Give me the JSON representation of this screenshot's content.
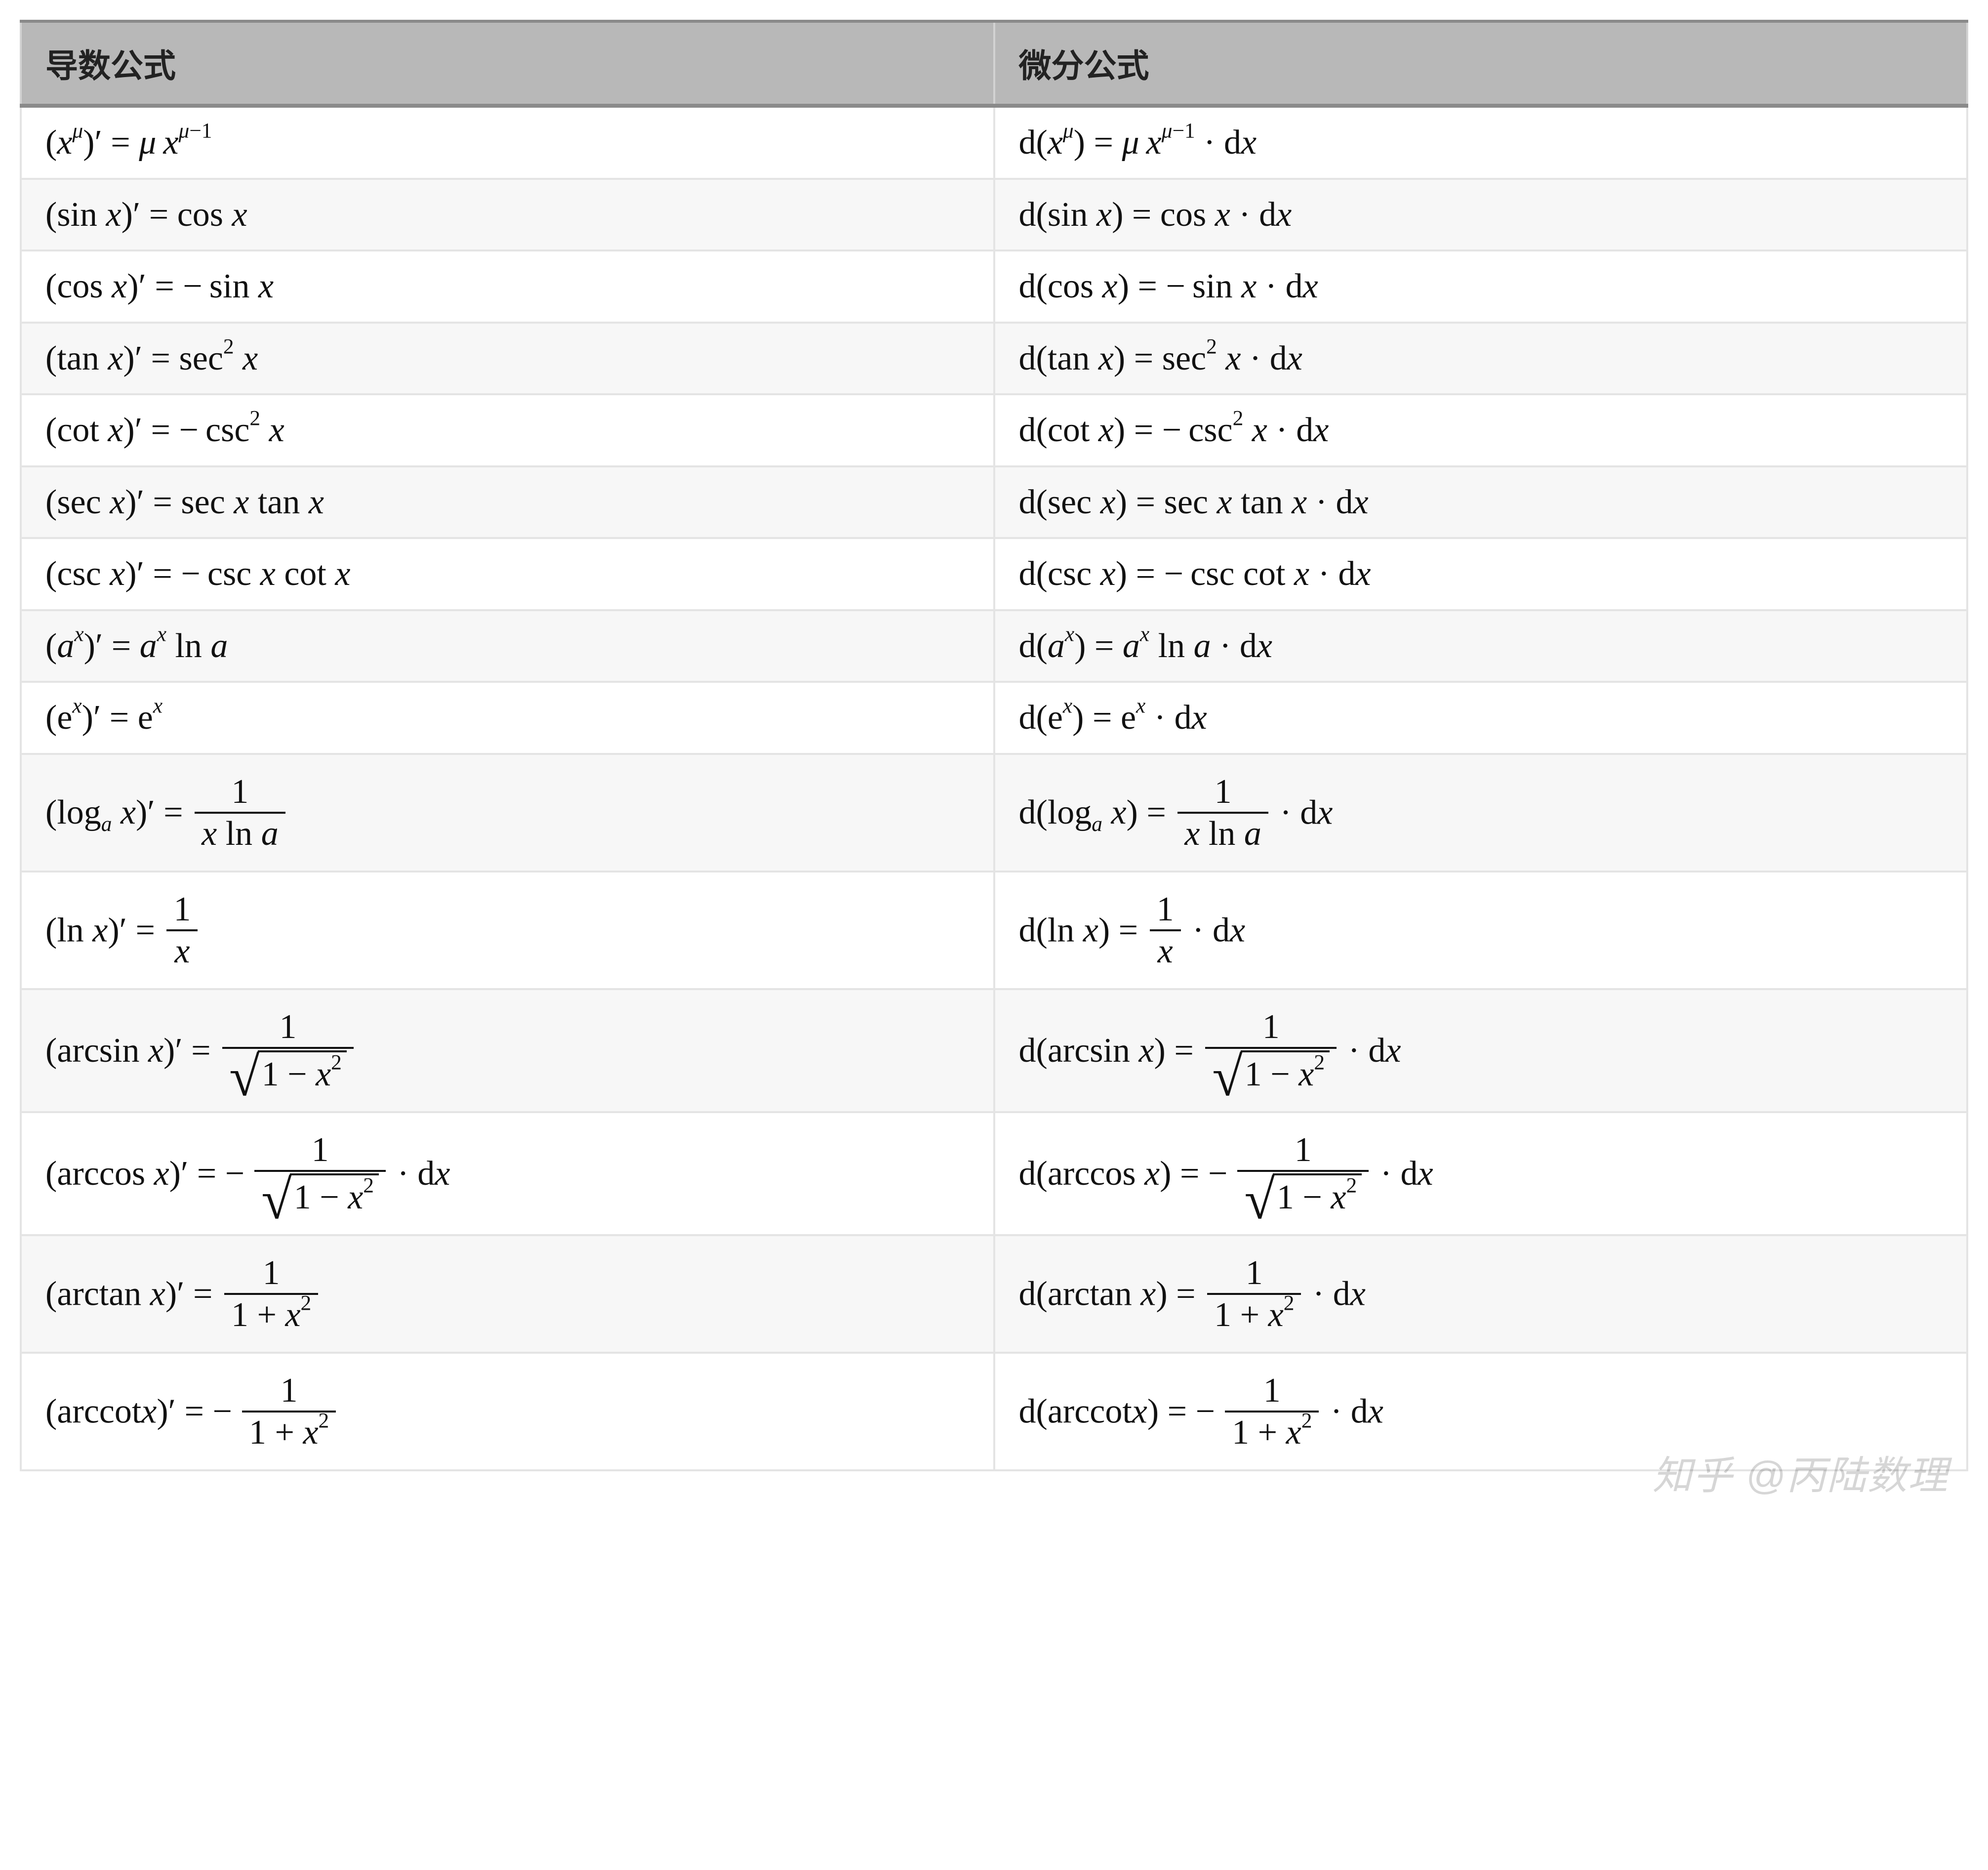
{
  "headers": {
    "derivative": "导数公式",
    "differential": "微分公式"
  },
  "rows": [
    {
      "derivative_html": "(<span class='mi'>x</span><sup><span class='mi'>μ</span></sup>)<span class='mr'>′</span> = <span class='mi'>μ</span>&thinsp;<span class='mi'>x</span><sup><span class='mi'>μ</span>−1</sup>",
      "differential_html": "<span class='mr'>d</span>(<span class='mi'>x</span><sup><span class='mi'>μ</span></sup>) = <span class='mi'>μ</span>&thinsp;<span class='mi'>x</span><sup><span class='mi'>μ</span>−1</sup> · <span class='mr'>d</span><span class='mi'>x</span>"
    },
    {
      "derivative_html": "(<span class='op'>sin</span> <span class='mi'>x</span>)<span class='mr'>′</span> = <span class='op'>cos</span> <span class='mi'>x</span>",
      "differential_html": "<span class='mr'>d</span>(<span class='op'>sin</span> <span class='mi'>x</span>) = <span class='op'>cos</span> <span class='mi'>x</span> · <span class='mr'>d</span><span class='mi'>x</span>"
    },
    {
      "derivative_html": "(<span class='op'>cos</span> <span class='mi'>x</span>)<span class='mr'>′</span> = −&thinsp;<span class='op'>sin</span> <span class='mi'>x</span>",
      "differential_html": "<span class='mr'>d</span>(<span class='op'>cos</span> <span class='mi'>x</span>) = −&thinsp;<span class='op'>sin</span> <span class='mi'>x</span> · <span class='mr'>d</span><span class='mi'>x</span>"
    },
    {
      "derivative_html": "(<span class='op'>tan</span> <span class='mi'>x</span>)<span class='mr'>′</span> = <span class='op'>sec</span><sup>2</sup> <span class='mi'>x</span>",
      "differential_html": "<span class='mr'>d</span>(<span class='op'>tan</span> <span class='mi'>x</span>) = <span class='op'>sec</span><sup>2</sup> <span class='mi'>x</span> · <span class='mr'>d</span><span class='mi'>x</span>"
    },
    {
      "derivative_html": "(<span class='op'>cot</span> <span class='mi'>x</span>)<span class='mr'>′</span> = −&thinsp;<span class='op'>csc</span><sup>2</sup> <span class='mi'>x</span>",
      "differential_html": "<span class='mr'>d</span>(<span class='op'>cot</span> <span class='mi'>x</span>) = −&thinsp;<span class='op'>csc</span><sup>2</sup> <span class='mi'>x</span> · <span class='mr'>d</span><span class='mi'>x</span>"
    },
    {
      "derivative_html": "(<span class='op'>sec</span> <span class='mi'>x</span>)<span class='mr'>′</span> = <span class='op'>sec</span> <span class='mi'>x</span>&nbsp;<span class='op'>tan</span> <span class='mi'>x</span>",
      "differential_html": "<span class='mr'>d</span>(<span class='op'>sec</span> <span class='mi'>x</span>) = <span class='op'>sec</span> <span class='mi'>x</span>&nbsp;<span class='op'>tan</span> <span class='mi'>x</span> · <span class='mr'>d</span><span class='mi'>x</span>"
    },
    {
      "derivative_html": "(<span class='op'>csc</span> <span class='mi'>x</span>)<span class='mr'>′</span> = −&thinsp;<span class='op'>csc</span> <span class='mi'>x</span>&nbsp;<span class='op'>cot</span> <span class='mi'>x</span>",
      "differential_html": "<span class='mr'>d</span>(<span class='op'>csc</span> <span class='mi'>x</span>) = −&thinsp;<span class='op'>csc</span>&nbsp;<span class='op'>cot</span> <span class='mi'>x</span> · <span class='mr'>d</span><span class='mi'>x</span>"
    },
    {
      "derivative_html": "(<span class='mi'>a</span><sup><span class='mi'>x</span></sup>)<span class='mr'>′</span> = <span class='mi'>a</span><sup><span class='mi'>x</span></sup>&nbsp;<span class='op'>ln</span> <span class='mi'>a</span>",
      "differential_html": "<span class='mr'>d</span>(<span class='mi'>a</span><sup><span class='mi'>x</span></sup>) = <span class='mi'>a</span><sup><span class='mi'>x</span></sup>&nbsp;<span class='op'>ln</span> <span class='mi'>a</span> · <span class='mr'>d</span><span class='mi'>x</span>"
    },
    {
      "derivative_html": "(<span class='mr'>e</span><sup><span class='mi'>x</span></sup>)<span class='mr'>′</span> = <span class='mr'>e</span><sup><span class='mi'>x</span></sup>",
      "differential_html": "<span class='mr'>d</span>(<span class='mr'>e</span><sup><span class='mi'>x</span></sup>) = <span class='mr'>e</span><sup><span class='mi'>x</span></sup> · <span class='mr'>d</span><span class='mi'>x</span>"
    },
    {
      "derivative_html": "<span class='mid'>(<span class='op'>log</span><sub><span class='mi'>a</span></sub> <span class='mi'>x</span>)<span class='mr'>′</span> = </span><span class='frac'><span class='num'>1</span><span class='den'><span class='mi'>x</span>&nbsp;<span class='op'>ln</span> <span class='mi'>a</span></span></span>",
      "differential_html": "<span class='mid'><span class='mr'>d</span>(<span class='op'>log</span><sub><span class='mi'>a</span></sub> <span class='mi'>x</span>) = </span><span class='frac'><span class='num'>1</span><span class='den'><span class='mi'>x</span>&nbsp;<span class='op'>ln</span> <span class='mi'>a</span></span></span><span class='mid'> · <span class='mr'>d</span><span class='mi'>x</span></span>"
    },
    {
      "derivative_html": "<span class='mid'>(<span class='op'>ln</span> <span class='mi'>x</span>)<span class='mr'>′</span> = </span><span class='frac'><span class='num'>1</span><span class='den'><span class='mi'>x</span></span></span>",
      "differential_html": "<span class='mid'><span class='mr'>d</span>(<span class='op'>ln</span> <span class='mi'>x</span>) = </span><span class='frac'><span class='num'>1</span><span class='den'><span class='mi'>x</span></span></span><span class='mid'> · <span class='mr'>d</span><span class='mi'>x</span></span>"
    },
    {
      "derivative_html": "<span class='mid'>(<span class='op'>arcsin</span> <span class='mi'>x</span>)<span class='mr'>′</span> = </span><span class='frac'><span class='num'>1</span><span class='den'><span class='sqrt'><span class='surd'>√</span><span class='radicand'>1 − <span class='mi'>x</span><sup>2</sup></span></span></span></span>",
      "differential_html": "<span class='mid'><span class='mr'>d</span>(<span class='op'>arcsin</span> <span class='mi'>x</span>) = </span><span class='frac'><span class='num'>1</span><span class='den'><span class='sqrt'><span class='surd'>√</span><span class='radicand'>1 − <span class='mi'>x</span><sup>2</sup></span></span></span></span><span class='mid'> · <span class='mr'>d</span><span class='mi'>x</span></span>"
    },
    {
      "derivative_html": "<span class='mid'>(<span class='op'>arccos</span> <span class='mi'>x</span>)<span class='mr'>′</span> = −&thinsp;</span><span class='frac'><span class='num'>1</span><span class='den'><span class='sqrt'><span class='surd'>√</span><span class='radicand'>1 − <span class='mi'>x</span><sup>2</sup></span></span></span></span><span class='mid'> · <span class='mr'>d</span><span class='mi'>x</span></span>",
      "differential_html": "<span class='mid'><span class='mr'>d</span>(<span class='op'>arccos</span> <span class='mi'>x</span>) = −&thinsp;</span><span class='frac'><span class='num'>1</span><span class='den'><span class='sqrt'><span class='surd'>√</span><span class='radicand'>1 − <span class='mi'>x</span><sup>2</sup></span></span></span></span><span class='mid'> · <span class='mr'>d</span><span class='mi'>x</span></span>"
    },
    {
      "derivative_html": "<span class='mid'>(<span class='op'>arctan</span> <span class='mi'>x</span>)<span class='mr'>′</span> = </span><span class='frac'><span class='num'>1</span><span class='den'>1 + <span class='mi'>x</span><sup>2</sup></span></span>",
      "differential_html": "<span class='mid'><span class='mr'>d</span>(<span class='op'>arctan</span> <span class='mi'>x</span>) = </span><span class='frac'><span class='num'>1</span><span class='den'>1 + <span class='mi'>x</span><sup>2</sup></span></span><span class='mid'> · <span class='mr'>d</span><span class='mi'>x</span></span>"
    },
    {
      "derivative_html": "<span class='mid'>(<span class='op'>arccot</span><span class='mi'>x</span>)<span class='mr'>′</span> = −&thinsp;</span><span class='frac'><span class='num'>1</span><span class='den'>1 + <span class='mi'>x</span><sup>2</sup></span></span>",
      "differential_html": "<span class='mid'><span class='mr'>d</span>(<span class='op'>arccot</span><span class='mi'>x</span>) = −&thinsp;</span><span class='frac'><span class='num'>1</span><span class='den'>1 + <span class='mi'>x</span><sup>2</sup></span></span><span class='mid'> · <span class='mr'>d</span><span class='mi'>x</span></span>"
    }
  ],
  "watermark": "知乎 @丙陆数理"
}
